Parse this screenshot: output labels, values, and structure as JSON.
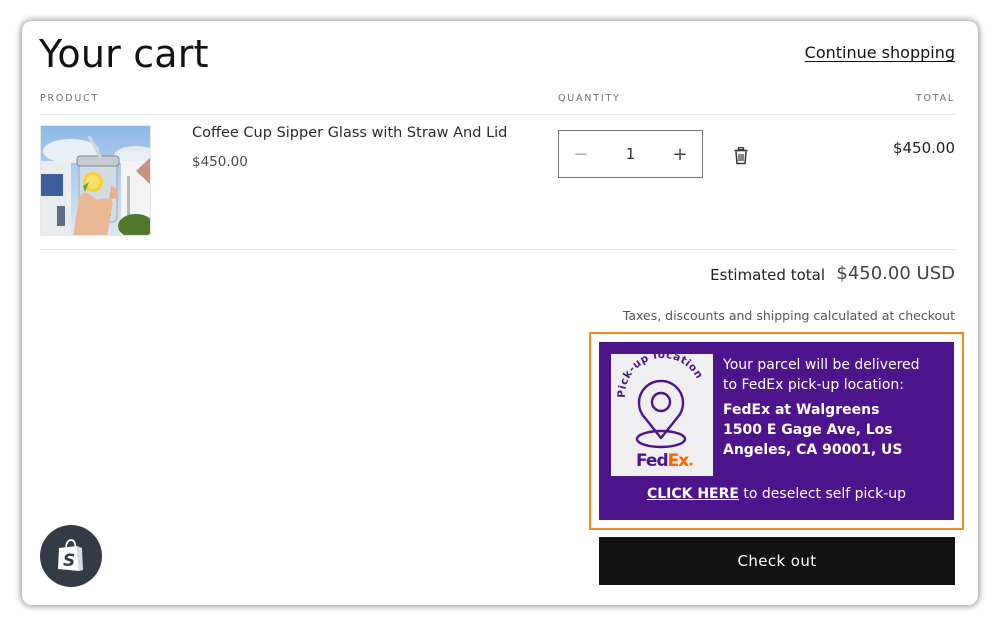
{
  "header": {
    "title": "Your cart",
    "continue_shopping": "Continue shopping"
  },
  "columns": {
    "product": "PRODUCT",
    "quantity": "QUANTITY",
    "total": "TOTAL"
  },
  "items": [
    {
      "name": "Coffee Cup Sipper Glass with Straw And Lid",
      "price": "$450.00",
      "quantity": "1",
      "line_total": "$450.00",
      "image_icon": "product-photo-glass-cup"
    }
  ],
  "quantity_controls": {
    "decrease": "−",
    "increase": "+"
  },
  "summary": {
    "estimated_label": "Estimated total",
    "estimated_value": "$450.00 USD",
    "taxes_note": "Taxes, discounts and shipping calculated at checkout"
  },
  "fedex": {
    "logo_arc_text": "Pick-up location",
    "logo_brand_fed": "Fed",
    "logo_brand_ex": "Ex",
    "intro_line1": "Your parcel will be delivered",
    "intro_line2": "to FedEx pick-up location:",
    "location_name": "FedEx at Walgreens",
    "address_line1": "1500 E Gage Ave, Los",
    "address_line2": "Angeles, CA 90001, US",
    "click_here": "CLICK HERE",
    "deselect_text": " to deselect self pick-up",
    "colors": {
      "purple": "#4d148c",
      "orange": "#ff6200",
      "frame": "#f08a1c"
    }
  },
  "checkout": {
    "label": "Check out"
  },
  "badge": {
    "icon": "shopify-bag-icon"
  }
}
